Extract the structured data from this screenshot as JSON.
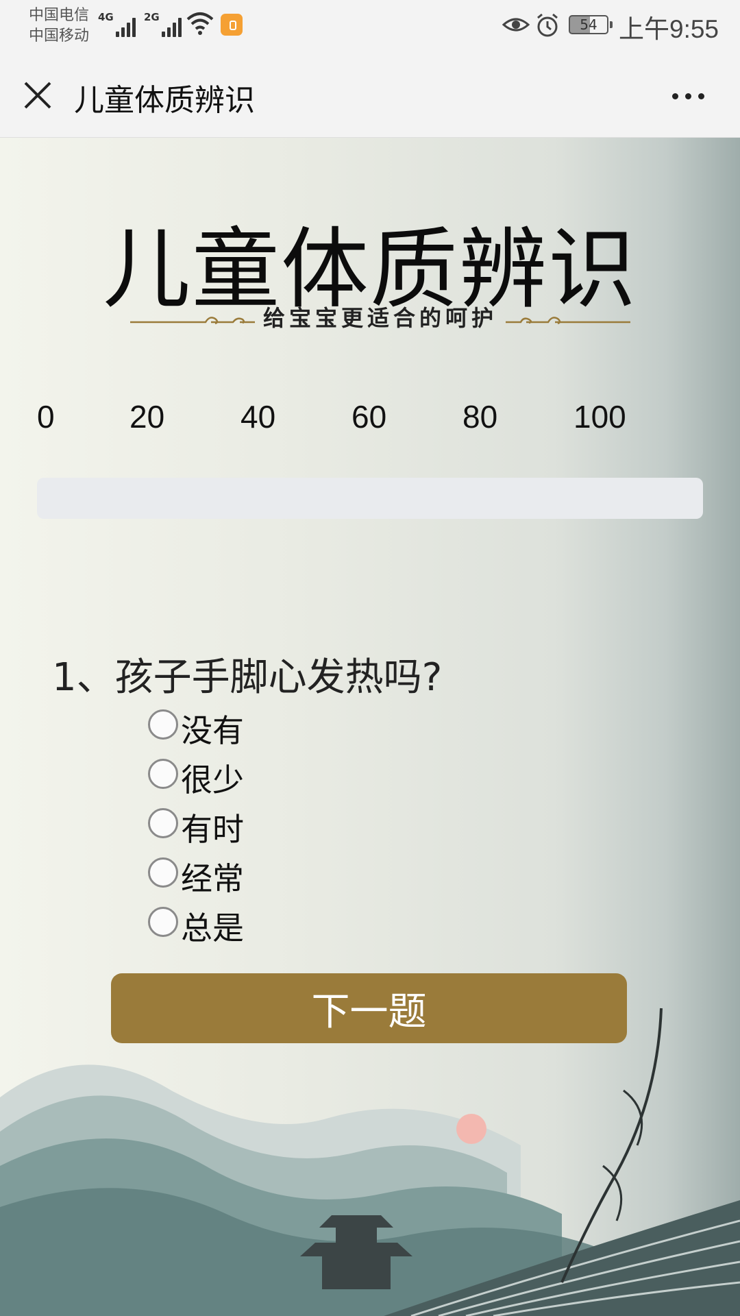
{
  "status_bar": {
    "carrier_1": "中国电信",
    "carrier_2": "中国移动",
    "network_1": "4G",
    "network_2": "2G",
    "battery": "54",
    "time": "上午9:55"
  },
  "nav": {
    "title": "儿童体质辨识",
    "close_icon": "close-icon",
    "more_icon": "more-icon"
  },
  "header": {
    "title": "儿童体质辨识",
    "subtitle": "给宝宝更适合的呵护"
  },
  "progress": {
    "scale": [
      "0",
      "20",
      "40",
      "60",
      "80",
      "100"
    ],
    "value_percent": 0
  },
  "question": {
    "text": "1、孩子手脚心发热吗?",
    "options": [
      "没有",
      "很少",
      "有时",
      "经常",
      "总是"
    ],
    "selected": null
  },
  "actions": {
    "next_label": "下一题"
  },
  "colors": {
    "accent": "#9a7b3a",
    "track": "#e9ebee",
    "nav_bg": "#f3f3f3"
  }
}
